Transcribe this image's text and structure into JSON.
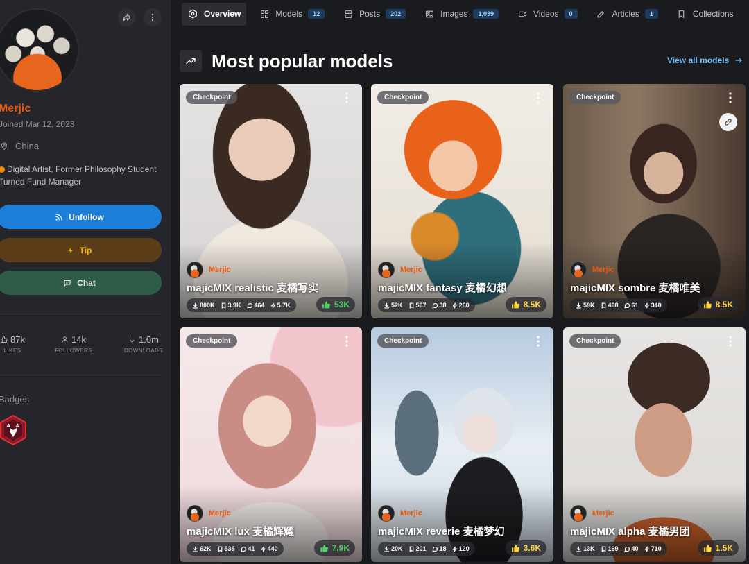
{
  "profile": {
    "username": "Merjic",
    "joined": "Joined Mar 12, 2023",
    "location": "China",
    "bio": "Digital Artist, Former Philosophy Student Turned Fund Manager",
    "buttons": {
      "unfollow": "Unfollow",
      "tip": "Tip",
      "chat": "Chat"
    },
    "stats": [
      {
        "value": "87k",
        "label": "LIKES"
      },
      {
        "value": "14k",
        "label": "FOLLOWERS"
      },
      {
        "value": "1.0m",
        "label": "DOWNLOADS"
      }
    ],
    "badges_title": "Badges"
  },
  "tabs": [
    {
      "label": "Overview",
      "count": ""
    },
    {
      "label": "Models",
      "count": "12"
    },
    {
      "label": "Posts",
      "count": "202"
    },
    {
      "label": "Images",
      "count": "1,039"
    },
    {
      "label": "Videos",
      "count": "0"
    },
    {
      "label": "Articles",
      "count": "1"
    },
    {
      "label": "Collections",
      "count": ""
    }
  ],
  "section": {
    "title": "Most popular models",
    "view_all": "View all models"
  },
  "cards": [
    {
      "chip": "Checkpoint",
      "creator": "Merjic",
      "title": "majicMIX realistic 麦橘写实",
      "downloads": "800K",
      "saves": "3.9K",
      "comments": "464",
      "buzz": "5.7K",
      "likes": "53K",
      "likes_color": "green"
    },
    {
      "chip": "Checkpoint",
      "creator": "Merjic",
      "title": "majicMIX fantasy 麦橘幻想",
      "downloads": "52K",
      "saves": "567",
      "comments": "38",
      "buzz": "260",
      "likes": "8.5K",
      "likes_color": "orange"
    },
    {
      "chip": "Checkpoint",
      "creator": "Merjic",
      "title": "majicMIX sombre 麦橘唯美",
      "downloads": "59K",
      "saves": "498",
      "comments": "61",
      "buzz": "340",
      "likes": "8.5K",
      "likes_color": "orange"
    },
    {
      "chip": "Checkpoint",
      "creator": "Merjic",
      "title": "majicMIX lux 麦橘辉耀",
      "downloads": "62K",
      "saves": "535",
      "comments": "41",
      "buzz": "440",
      "likes": "7.9K",
      "likes_color": "green"
    },
    {
      "chip": "Checkpoint",
      "creator": "Merjic",
      "title": "majicMIX reverie 麦橘梦幻",
      "downloads": "20K",
      "saves": "201",
      "comments": "18",
      "buzz": "120",
      "likes": "3.6K",
      "likes_color": "orange"
    },
    {
      "chip": "Checkpoint",
      "creator": "Merjic",
      "title": "majicMIX alpha 麦橘男团",
      "downloads": "13K",
      "saves": "169",
      "comments": "40",
      "buzz": "710",
      "likes": "1.5K",
      "likes_color": "orange"
    }
  ]
}
